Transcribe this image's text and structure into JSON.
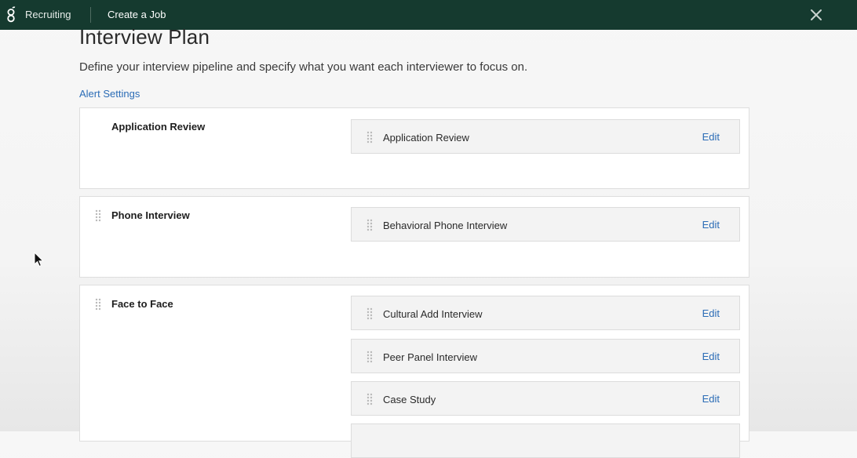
{
  "topbar": {
    "app_name": "Recruiting",
    "page_name": "Create a Job",
    "logo_icon": "greenhouse-logo-icon",
    "close_icon": "close-icon",
    "background_color": "#153a2f"
  },
  "page": {
    "title": "Interview Plan",
    "subtitle": "Define your interview pipeline and specify what you want each interviewer to focus on.",
    "alert_link": "Alert Settings"
  },
  "accent_color": "#2b6cb6",
  "stages": [
    {
      "name": "Application Review",
      "draggable": false,
      "interviews": [
        {
          "name": "Application Review",
          "action": "Edit"
        }
      ]
    },
    {
      "name": "Phone Interview",
      "draggable": true,
      "interviews": [
        {
          "name": "Behavioral Phone Interview",
          "action": "Edit"
        }
      ]
    },
    {
      "name": "Face to Face",
      "draggable": true,
      "interviews": [
        {
          "name": "Cultural Add Interview",
          "action": "Edit"
        },
        {
          "name": "Peer Panel Interview",
          "action": "Edit"
        },
        {
          "name": "Case Study",
          "action": "Edit"
        },
        {
          "name": "",
          "action": ""
        }
      ]
    }
  ]
}
